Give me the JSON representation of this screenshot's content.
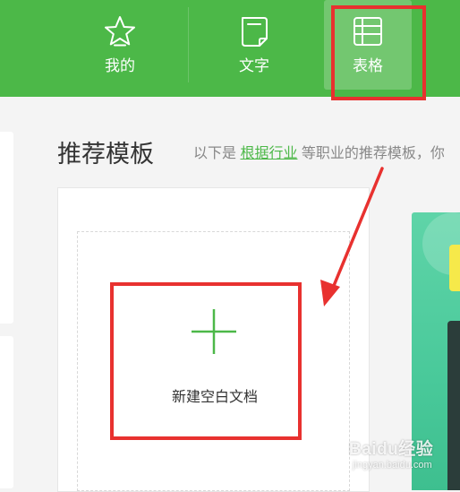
{
  "header": {
    "tabs": [
      {
        "label": "我的",
        "icon": "star-icon"
      },
      {
        "label": "文字",
        "icon": "document-icon"
      },
      {
        "label": "表格",
        "icon": "table-icon",
        "active": true
      }
    ]
  },
  "main": {
    "title": "推荐模板",
    "description": {
      "prefix": "以下是 ",
      "link": "根据行业",
      "suffix": " 等职业的推荐模板，你"
    },
    "new_card": {
      "label": "新建空白文档",
      "icon": "plus-icon"
    }
  },
  "watermark": {
    "main": "Baidu经验",
    "sub": "jingyan.baidu.com"
  },
  "colors": {
    "brand_green": "#4cb848",
    "annotation_red": "#e8312f",
    "template_teal": "#49c99a"
  }
}
